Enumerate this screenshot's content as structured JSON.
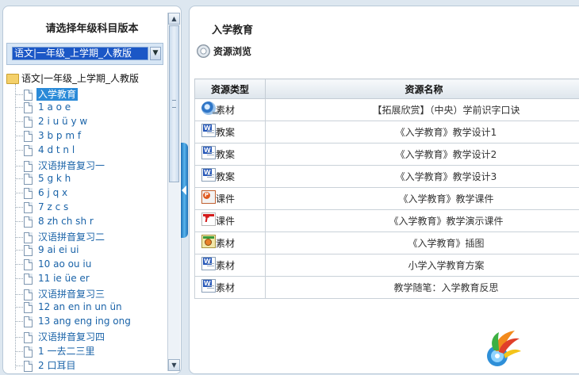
{
  "left_panel": {
    "title": "请选择年级科目版本",
    "select_value": "语文|一年级_上学期_人教版",
    "root_label": "语文|一年级_上学期_人教版",
    "items": [
      {
        "label": "入学教育",
        "selected": true
      },
      {
        "label": "1 a o e"
      },
      {
        "label": "2 i u ü y w"
      },
      {
        "label": "3 b p m f"
      },
      {
        "label": "4 d t n l"
      },
      {
        "label": "汉语拼音复习一"
      },
      {
        "label": "5 g k h"
      },
      {
        "label": "6 j q x"
      },
      {
        "label": "7 z c s"
      },
      {
        "label": "8 zh ch sh r"
      },
      {
        "label": "汉语拼音复习二"
      },
      {
        "label": "9 ai ei ui"
      },
      {
        "label": "10 ao ou iu"
      },
      {
        "label": "11 ie üe er"
      },
      {
        "label": "汉语拼音复习三"
      },
      {
        "label": "12 an en in un ün"
      },
      {
        "label": "13 ang eng ing ong"
      },
      {
        "label": "汉语拼音复习四"
      },
      {
        "label": "1 一去二三里"
      },
      {
        "label": "2 口耳目"
      }
    ]
  },
  "right_panel": {
    "title": "入学教育",
    "browse_label": "资源浏览",
    "table": {
      "headers": [
        "资源类型",
        "资源名称"
      ],
      "rows": [
        {
          "icon": "video-icon",
          "type": "素材",
          "name": "【拓展欣赏】（中央）学前识字口诀"
        },
        {
          "icon": "word-doc-icon",
          "type": "教案",
          "name": "《入学教育》教学设计1"
        },
        {
          "icon": "word-doc-icon",
          "type": "教案",
          "name": "《入学教育》教学设计2"
        },
        {
          "icon": "word-doc-icon",
          "type": "教案",
          "name": "《入学教育》教学设计3"
        },
        {
          "icon": "ppt-icon",
          "type": "课件",
          "name": "《入学教育》教学课件"
        },
        {
          "icon": "flash-icon",
          "type": "课件",
          "name": "《入学教育》教学演示课件"
        },
        {
          "icon": "image-icon",
          "type": "素材",
          "name": "《入学教育》插图"
        },
        {
          "icon": "word-doc-icon",
          "type": "素材",
          "name": "小学入学教育方案"
        },
        {
          "icon": "word-doc-icon",
          "type": "素材",
          "name": "教学随笔：入学教育反思"
        }
      ]
    }
  },
  "colors": {
    "background": "#dde7f0",
    "selected": "#2a8ad8",
    "link": "#1a63a8",
    "splitter": "#1d6fb5"
  }
}
